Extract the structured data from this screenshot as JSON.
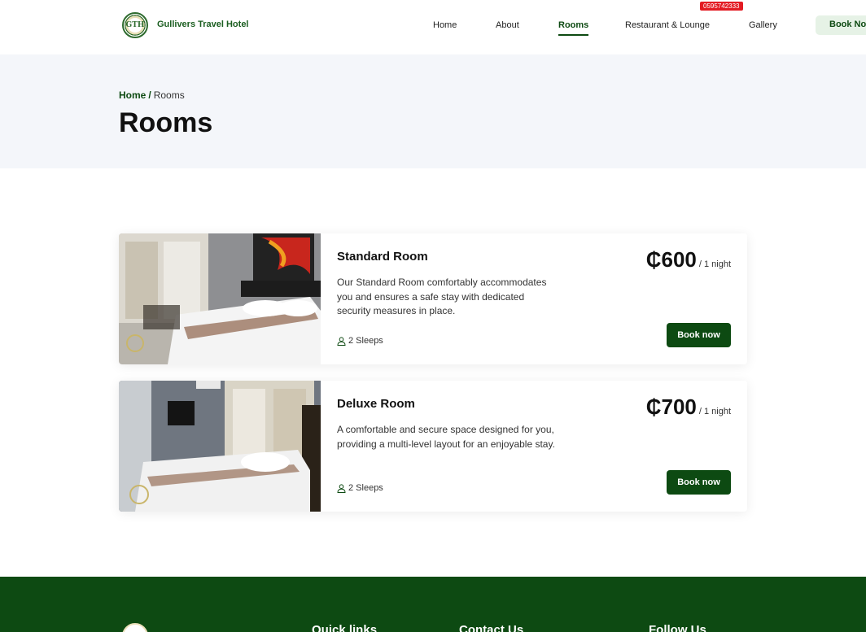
{
  "header": {
    "logo_text": "GTH",
    "brand": "Gullivers Travel Hotel",
    "nav": {
      "home": "Home",
      "about": "About",
      "rooms": "Rooms",
      "restaurant": "Restaurant & Lounge",
      "gallery": "Gallery"
    },
    "phone_badge": "0595742333",
    "book_now": "Book Now"
  },
  "hero": {
    "breadcrumb_home": "Home",
    "breadcrumb_sep": "/",
    "breadcrumb_current": "Rooms",
    "title": "Rooms"
  },
  "rooms": [
    {
      "name": "Standard Room",
      "description": "Our Standard Room comfortably accommodates you and ensures a safe stay with dedicated security measures in place.",
      "sleeps": "2 Sleeps",
      "price": "₵600",
      "per": "/ 1 night",
      "book_label": "Book now"
    },
    {
      "name": "Deluxe Room",
      "description": "A comfortable and secure space designed for you, providing a multi-level layout for an enjoyable stay.",
      "sleeps": "2 Sleeps",
      "price": "₵700",
      "per": "/ 1 night",
      "book_label": "Book now"
    }
  ],
  "footer": {
    "quick_links": "Quick links",
    "contact_us": "Contact Us",
    "follow_us": "Follow Us"
  },
  "colors": {
    "brand_green": "#0d4a12",
    "badge_red": "#e31b23",
    "hero_bg": "#f4f6fa"
  }
}
